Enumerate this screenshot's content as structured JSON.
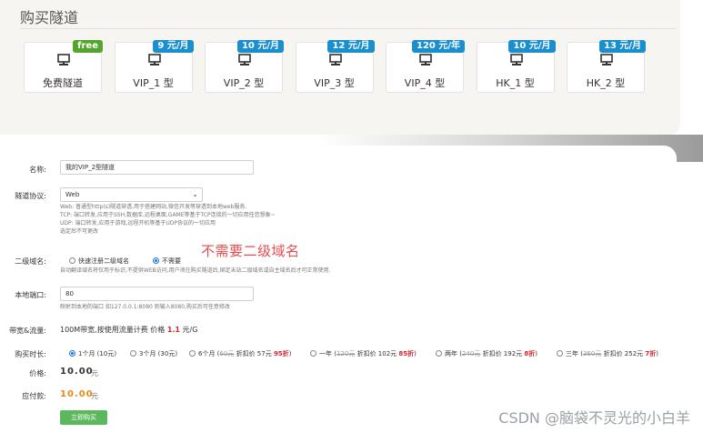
{
  "section_title": "购买隧道",
  "plans": [
    {
      "label": "免费隧道",
      "badge": "free",
      "badge_type": "free"
    },
    {
      "label": "VIP_1 型",
      "badge": "9 元/月",
      "badge_type": "price"
    },
    {
      "label": "VIP_2 型",
      "badge": "10 元/月",
      "badge_type": "price"
    },
    {
      "label": "VIP_3 型",
      "badge": "12 元/月",
      "badge_type": "price"
    },
    {
      "label": "VIP_4 型",
      "badge": "120 元/年",
      "badge_type": "price"
    },
    {
      "label": "HK_1 型",
      "badge": "10 元/月",
      "badge_type": "price"
    },
    {
      "label": "HK_2 型",
      "badge": "13 元/月",
      "badge_type": "price"
    }
  ],
  "colors": {
    "badge_free": "#52a62c",
    "badge_price": "#1a8fd0",
    "buy_button": "#5cb85c",
    "annotation": "#e74c4c",
    "accent_red": "#d9242c"
  },
  "form": {
    "name": {
      "label": "名称:",
      "value": "我的VIP_2型隧道"
    },
    "protocol": {
      "label": "隧道协议:",
      "selected": "Web",
      "help": [
        "Web: 普通型http(s)隧道穿透,用于搭建网站,微信开发等穿透到本地web服务.",
        "TCP: 端口转发,应用于SSH,数据库,远程桌面,GAME等基于TCP连接的一切应用任您想象~",
        "UDP: 端口转发,应用于游戏,远程开机等基于UDP协议的一切应用",
        "选定后不可更改"
      ]
    },
    "subdomain": {
      "label": "二级域名:",
      "option_quick": "快速注册二级域名",
      "option_none": "不需要",
      "selected": "不需要",
      "help": "自动翻译域名将仅用于标识,不提供WEB访问,用户须在购买隧道后,绑定未站二级域名或自主域名后才可正常使用."
    },
    "local_port": {
      "label": "本地端口:",
      "value": "80",
      "help": "映射到本地的端口 如127.0.0.1:8080 则输入8080,购买后可任意修改"
    },
    "bandwidth": {
      "label": "带宽&流量:",
      "text_prefix": "100M带宽,按使用流量计费 价格 ",
      "price": "1.1",
      "unit": " 元/G"
    },
    "duration": {
      "label": "购买时长:",
      "options": [
        {
          "text": "1个月 (10元)",
          "selected": true
        },
        {
          "text": "3个月 (30元)",
          "selected": false
        },
        {
          "pre": "6个月 (",
          "original": "60元",
          "mid": " 折扣价 57元 ",
          "discount": "95折",
          "post": ")",
          "selected": false
        },
        {
          "pre": "一年 (",
          "original": "120元",
          "mid": " 折扣价 102元 ",
          "discount": "85折",
          "post": ")",
          "selected": false
        },
        {
          "pre": "两年 (",
          "original": "240元",
          "mid": " 折扣价 192元 ",
          "discount": "8折",
          "post": ")",
          "selected": false
        },
        {
          "pre": "三年 (",
          "original": "360元",
          "mid": " 折扣价 252元 ",
          "discount": "7折",
          "post": ")",
          "selected": false
        }
      ]
    },
    "price": {
      "label": "价格:",
      "value": "10.00",
      "unit": "元"
    },
    "payable": {
      "label": "应付款:",
      "value": "10.00",
      "unit": "元"
    },
    "buy_button": "立即购买"
  },
  "annotation": "不需要二级域名",
  "watermark": "CSDN @脑袋不灵光的小白羊",
  "icons": {
    "plan": "server-icon",
    "select": "chevron-down-icon"
  }
}
